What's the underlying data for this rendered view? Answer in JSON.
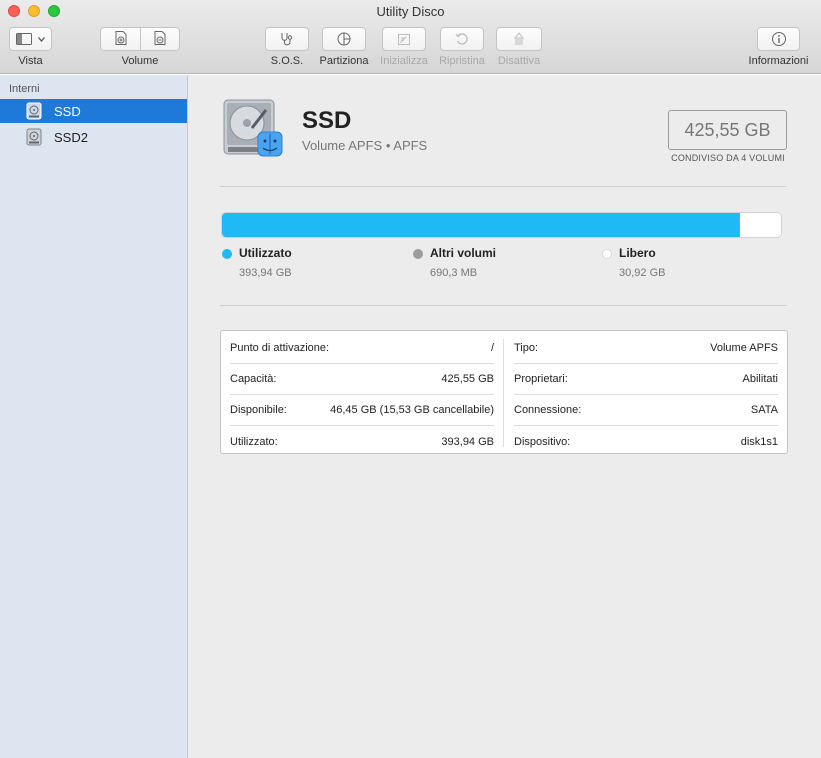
{
  "window": {
    "title": "Utility Disco"
  },
  "toolbar": {
    "vista_label": "Vista",
    "volume_label": "Volume",
    "sos_label": "S.O.S.",
    "partiziona_label": "Partiziona",
    "inizializza_label": "Inizializza",
    "ripristina_label": "Ripristina",
    "disattiva_label": "Disattiva",
    "informazioni_label": "Informazioni"
  },
  "sidebar": {
    "section_label": "Interni",
    "items": [
      {
        "label": "SSD",
        "selected": true
      },
      {
        "label": "SSD2",
        "selected": false
      }
    ]
  },
  "volume": {
    "name": "SSD",
    "subtitle": "Volume APFS • APFS",
    "capacity": "425,55 GB",
    "capacity_note": "CONDIVISO DA 4 VOLUMI"
  },
  "usage": {
    "used_fraction": 0.9256,
    "other_fraction": 0.0016,
    "legend": [
      {
        "name": "Utilizzato",
        "value": "393,94 GB",
        "color": "#1fb9f5"
      },
      {
        "name": "Altri volumi",
        "value": "690,3 MB",
        "color": "#9c9c9c"
      },
      {
        "name": "Libero",
        "value": "30,92 GB",
        "color": "#ffffff"
      }
    ]
  },
  "details": {
    "left": [
      {
        "key": "Punto di attivazione:",
        "value": "/"
      },
      {
        "key": "Capacità:",
        "value": "425,55 GB"
      },
      {
        "key": "Disponibile:",
        "value": "46,45 GB (15,53 GB cancellabile)"
      },
      {
        "key": "Utilizzato:",
        "value": "393,94 GB"
      }
    ],
    "right": [
      {
        "key": "Tipo:",
        "value": "Volume APFS"
      },
      {
        "key": "Proprietari:",
        "value": "Abilitati"
      },
      {
        "key": "Connessione:",
        "value": "SATA"
      },
      {
        "key": "Dispositivo:",
        "value": "disk1s1"
      }
    ]
  },
  "colors": {
    "accent": "#1e79d9",
    "used": "#1fb9f5",
    "sidebar": "#dde5f0"
  }
}
